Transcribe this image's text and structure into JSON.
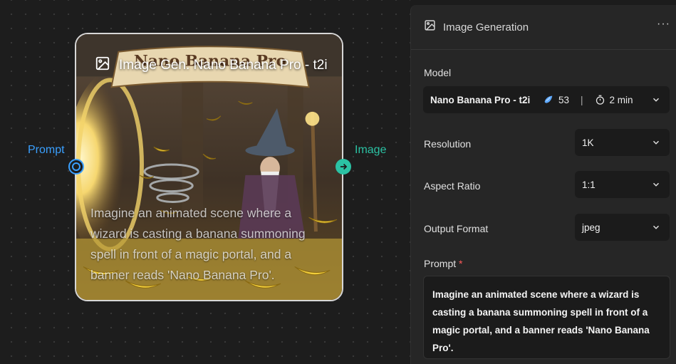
{
  "node": {
    "title": "Image Gen. Nano Banana Pro - t2i",
    "banner_text": "Nano Banana Pro",
    "prompt_lines": [
      "Imagine an animated scene where a",
      "wizard is casting a banana summoning",
      "spell in front of a magic portal, and a",
      "banner reads 'Nano Banana Pro'."
    ],
    "input_port_label": "Prompt",
    "output_port_label": "Image"
  },
  "panel": {
    "title": "Image Generation",
    "more_label": "···",
    "model": {
      "label": "Model",
      "value": "Nano Banana Pro - t2i",
      "cost": "53",
      "separator": "|",
      "time": "2 min"
    },
    "resolution": {
      "label": "Resolution",
      "value": "1K"
    },
    "aspect_ratio": {
      "label": "Aspect Ratio",
      "value": "1:1"
    },
    "output_format": {
      "label": "Output Format",
      "value": "jpeg"
    },
    "prompt": {
      "label": "Prompt",
      "required_mark": "*",
      "value": "Imagine an animated scene where a wizard is casting a banana summoning spell in front of a magic portal, and a banner reads 'Nano Banana Pro'."
    }
  },
  "colors": {
    "input_port": "#3aa0ff",
    "output_port": "#2bc2a4",
    "required": "#ff5a5a"
  }
}
